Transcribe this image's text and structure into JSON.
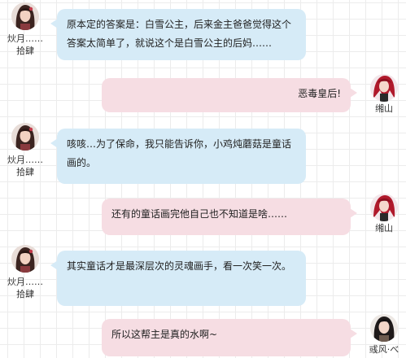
{
  "colors": {
    "left_bubble": "#d6ebf7",
    "right_bubble": "#f6dde3",
    "grid": "#ececec"
  },
  "messages": [
    {
      "side": "left",
      "avatar_icon": "female-character-avatar-icon",
      "name_line1": "炏月……",
      "name_line2": "拾肆",
      "text": "原本定的答案是：白雪公主，后来金主爸爸觉得这个答案太简单了，就说这个是白雪公主的后妈……"
    },
    {
      "side": "right",
      "avatar_icon": "red-haired-character-avatar-icon",
      "name_line1": "缃山",
      "text": "恶毒皇后!"
    },
    {
      "side": "left",
      "avatar_icon": "female-character-avatar-icon",
      "name_line1": "炏月……",
      "name_line2": "拾肆",
      "text": "咳咳…为了保命，我只能告诉你，小鸡炖蘑菇是童话画的。"
    },
    {
      "side": "right",
      "avatar_icon": "red-haired-character-avatar-icon",
      "name_line1": "缃山",
      "text": "还有的童话画完他自己也不知道是啥……"
    },
    {
      "side": "left",
      "avatar_icon": "female-character-avatar-icon",
      "name_line1": "炏月……",
      "name_line2": "拾肆",
      "text": "其实童话才是最深层次的灵魂画手，看一次笑一次。"
    },
    {
      "side": "right",
      "avatar_icon": "dark-haired-character-avatar-icon",
      "name_line1": "彧风·べ",
      "text": "所以这帮主是真的水啊~"
    }
  ]
}
